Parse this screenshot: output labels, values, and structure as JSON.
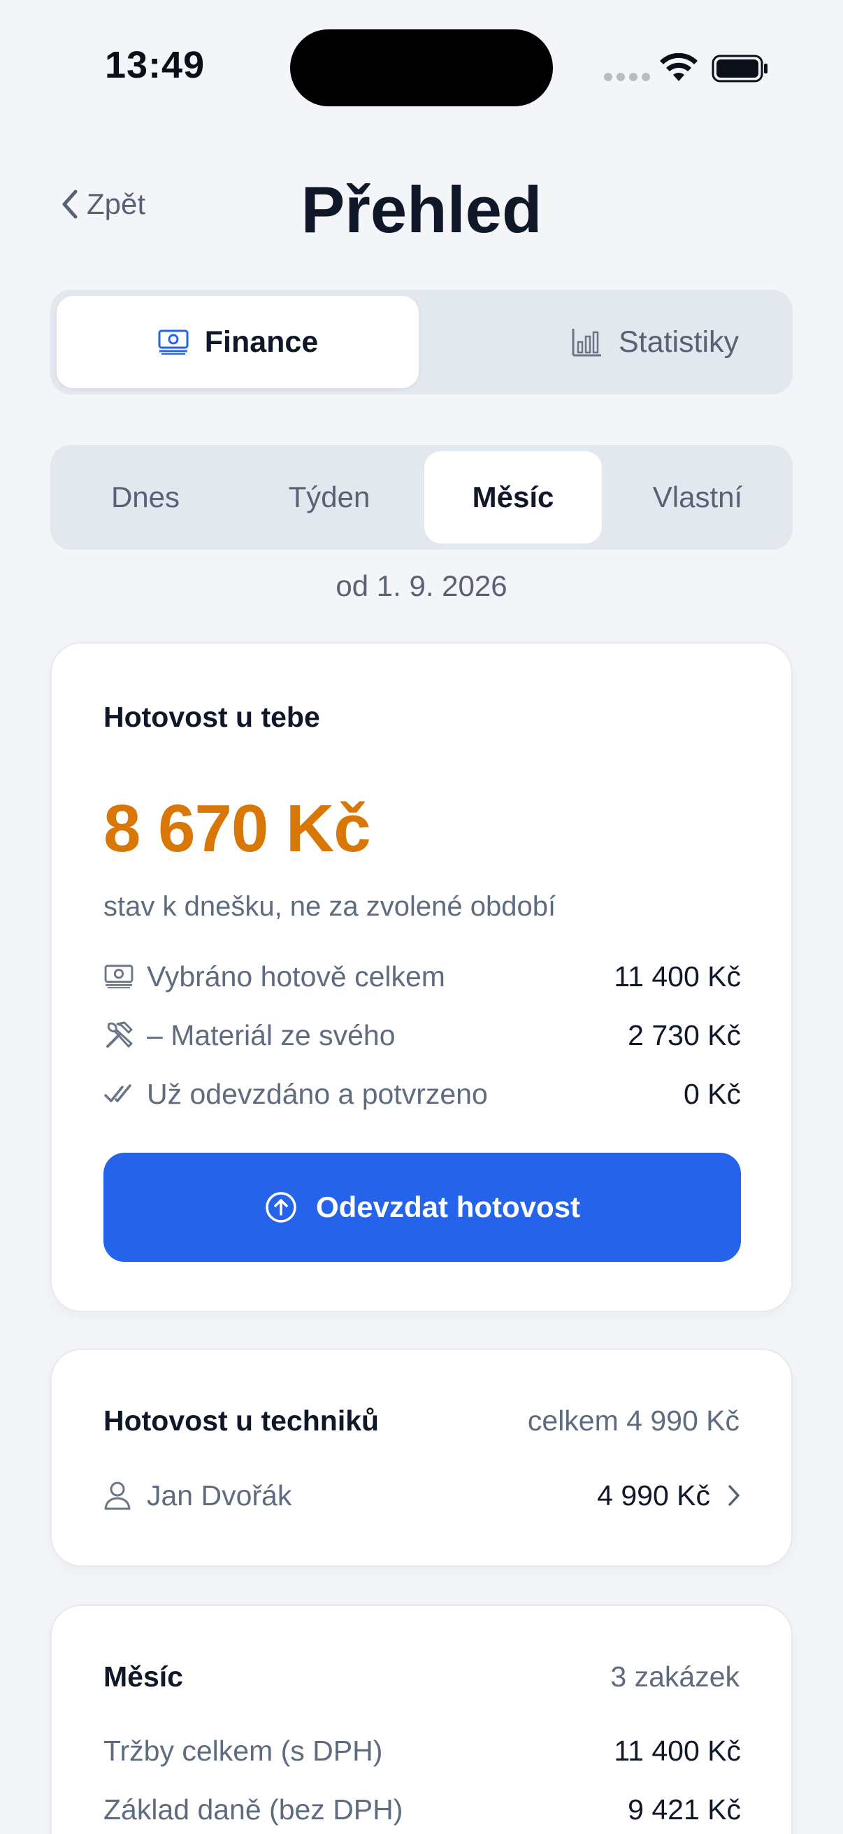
{
  "status_bar": {
    "time": "13:49"
  },
  "header": {
    "back_label": "Zpět",
    "title": "Přehled"
  },
  "main_tabs": [
    {
      "label": "Finance",
      "icon": "cash-icon",
      "active": true
    },
    {
      "label": "Statistiky",
      "icon": "bar-chart-icon",
      "active": false
    }
  ],
  "period_tabs": [
    {
      "label": "Dnes",
      "active": false
    },
    {
      "label": "Týden",
      "active": false
    },
    {
      "label": "Měsíc",
      "active": true
    },
    {
      "label": "Vlastní",
      "active": false
    }
  ],
  "period_since": "od 1. 9. 2026",
  "cash_card": {
    "title": "Hotovost u tebe",
    "amount": "8 670 Kč",
    "note": "stav k dnešku, ne za zvolené období",
    "rows": [
      {
        "icon": "cash-icon",
        "label": "Vybráno hotově celkem",
        "value": "11 400 Kč"
      },
      {
        "icon": "tools-icon",
        "label": "– Materiál ze svého",
        "value": "2 730 Kč"
      },
      {
        "icon": "double-check-icon",
        "label": "Už odevzdáno a potvrzeno",
        "value": "0 Kč"
      }
    ],
    "button_label": "Odevzdat hotovost"
  },
  "technicians_card": {
    "title": "Hotovost u techniků",
    "total": "celkem 4 990 Kč",
    "items": [
      {
        "name": "Jan Dvořák",
        "value": "4 990 Kč"
      }
    ]
  },
  "month_card": {
    "title": "Měsíc",
    "count": "3 zakázek",
    "rows": [
      {
        "label": "Tržby celkem (s DPH)",
        "value": "11 400 Kč"
      },
      {
        "label": "Základ daně (bez DPH)",
        "value": "9 421 Kč"
      }
    ]
  },
  "colors": {
    "background": "#f3f5f9",
    "accent": "#2563eb",
    "cash_amount": "#d97706",
    "muted_text": "#5f6b7e"
  }
}
